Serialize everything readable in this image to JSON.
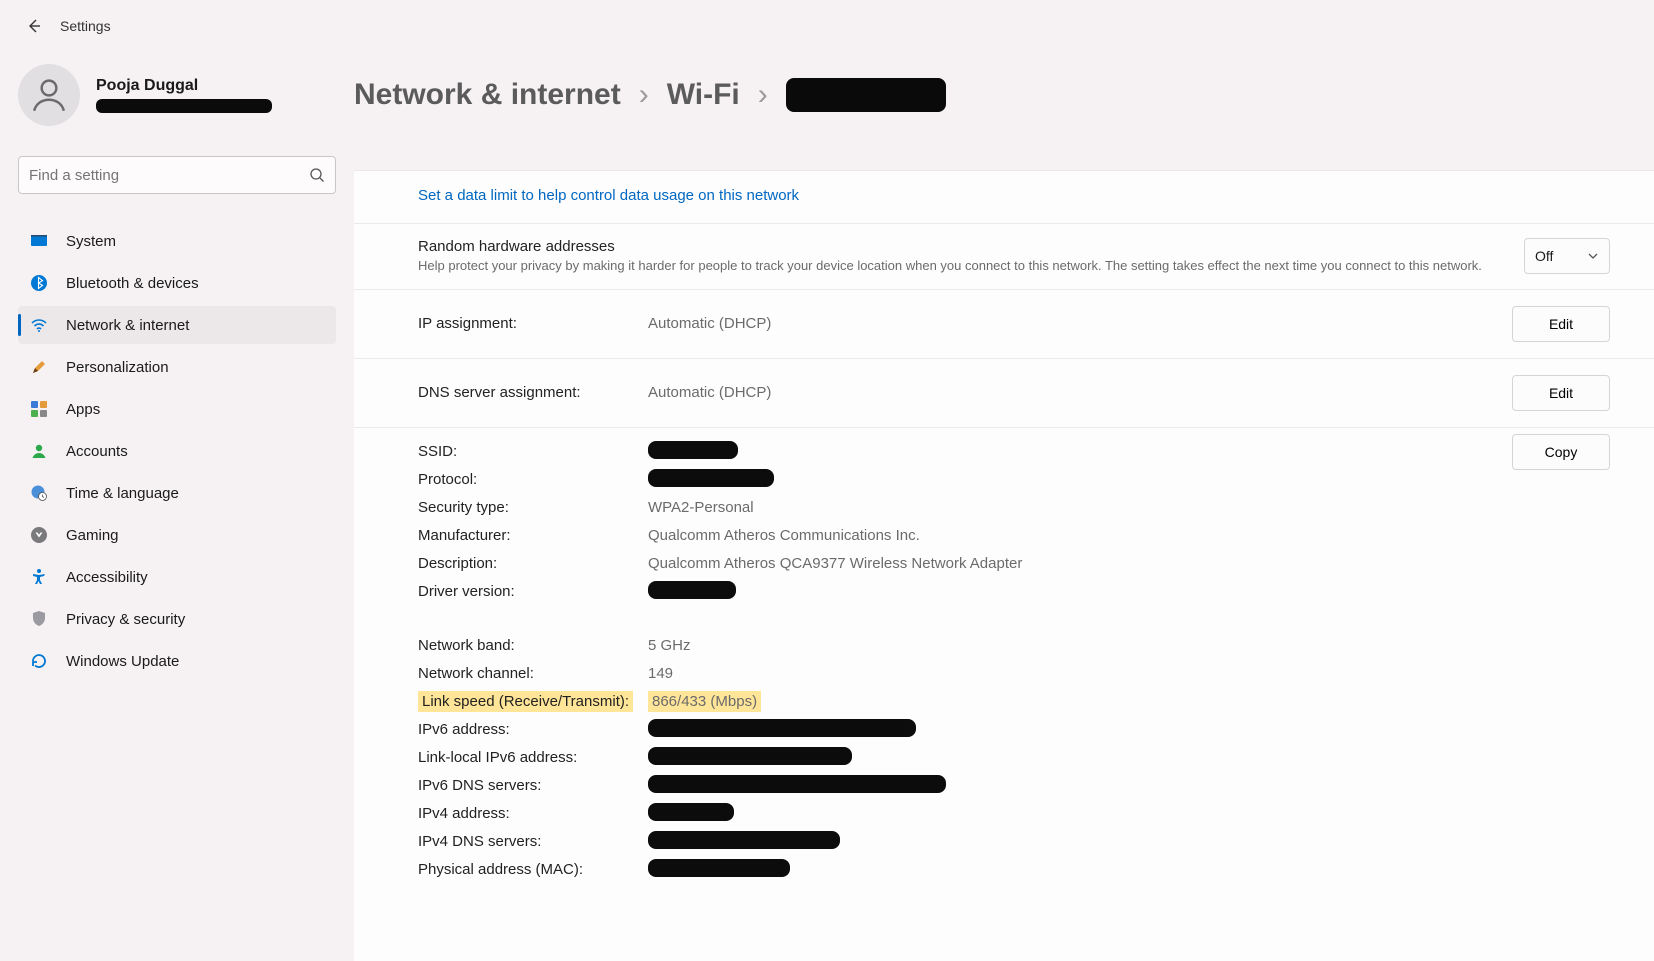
{
  "appTitle": "Settings",
  "user": {
    "name": "Pooja Duggal"
  },
  "search": {
    "placeholder": "Find a setting"
  },
  "nav": [
    {
      "key": "system",
      "label": "System"
    },
    {
      "key": "bluetooth",
      "label": "Bluetooth & devices"
    },
    {
      "key": "network",
      "label": "Network & internet"
    },
    {
      "key": "personalization",
      "label": "Personalization"
    },
    {
      "key": "apps",
      "label": "Apps"
    },
    {
      "key": "accounts",
      "label": "Accounts"
    },
    {
      "key": "time",
      "label": "Time & language"
    },
    {
      "key": "gaming",
      "label": "Gaming"
    },
    {
      "key": "accessibility",
      "label": "Accessibility"
    },
    {
      "key": "privacy",
      "label": "Privacy & security"
    },
    {
      "key": "update",
      "label": "Windows Update"
    }
  ],
  "crumbs": {
    "first": "Network & internet",
    "second": "Wi-Fi"
  },
  "dataLimitLink": "Set a data limit to help control data usage on this network",
  "randomHw": {
    "title": "Random hardware addresses",
    "desc": "Help protect your privacy by making it harder for people to track your device location when you connect to this network. The setting takes effect the next time you connect to this network.",
    "value": "Off"
  },
  "ipAssign": {
    "label": "IP assignment:",
    "value": "Automatic (DHCP)",
    "btn": "Edit"
  },
  "dnsAssign": {
    "label": "DNS server assignment:",
    "value": "Automatic (DHCP)",
    "btn": "Edit"
  },
  "copyBtn": "Copy",
  "props": {
    "ssidLabel": "SSID:",
    "protocolLabel": "Protocol:",
    "securityLabel": "Security type:",
    "securityValue": "WPA2-Personal",
    "manufLabel": "Manufacturer:",
    "manufValue": "Qualcomm Atheros Communications Inc.",
    "descLabel": "Description:",
    "descValue": "Qualcomm Atheros QCA9377 Wireless Network Adapter",
    "driverLabel": "Driver version:",
    "bandLabel": "Network band:",
    "bandValue": "5 GHz",
    "channelLabel": "Network channel:",
    "channelValue": "149",
    "linkLabel": "Link speed (Receive/Transmit):",
    "linkValue": "866/433 (Mbps)",
    "ipv6Label": "IPv6 address:",
    "llipv6Label": "Link-local IPv6 address:",
    "ipv6dnsLabel": "IPv6 DNS servers:",
    "ipv4Label": "IPv4 address:",
    "ipv4dnsLabel": "IPv4 DNS servers:",
    "macLabel": "Physical address (MAC):"
  },
  "redactWidths": {
    "ssid": 90,
    "protocol": 126,
    "driver": 88,
    "ipv6": 268,
    "llipv6": 204,
    "ipv6dns": 298,
    "ipv4": 86,
    "ipv4dns": 192,
    "mac": 142
  }
}
